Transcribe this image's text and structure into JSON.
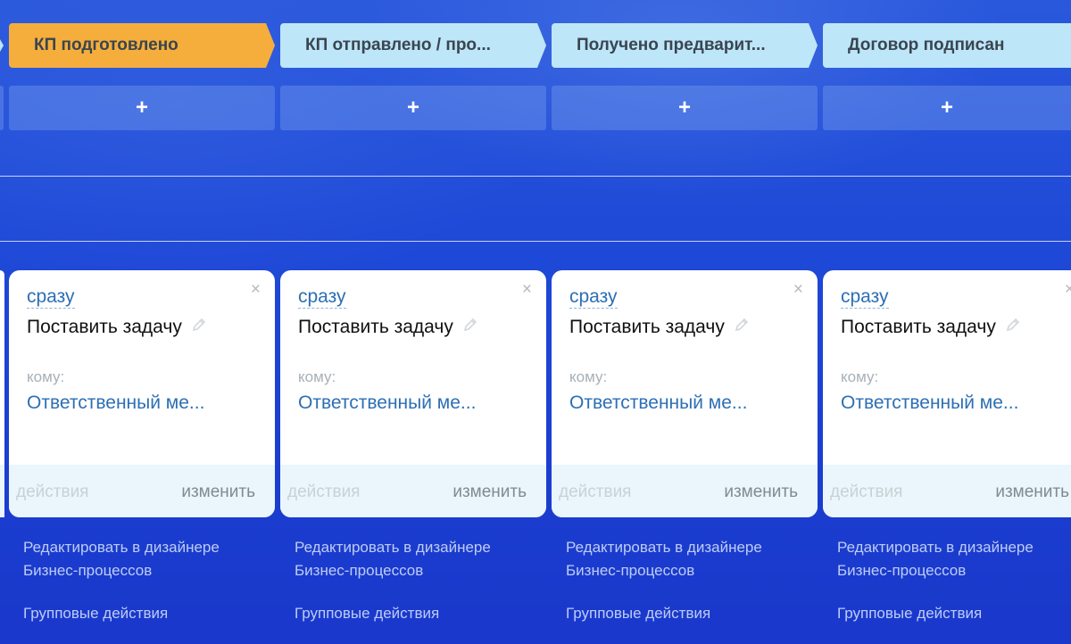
{
  "stages": [
    {
      "label": "КП подготовлено",
      "state": "active",
      "color": "#f5ae3c"
    },
    {
      "label": "КП отправлено / про...",
      "state": "normal",
      "color": "#bde6f8"
    },
    {
      "label": "Получено предварит...",
      "state": "normal",
      "color": "#bde6f8"
    },
    {
      "label": "Договор подписан",
      "state": "normal",
      "color": "#bde6f8"
    }
  ],
  "add_button": {
    "label": "+"
  },
  "cards": [
    {
      "when": "сразу",
      "close": "×",
      "task": "Поставить задачу",
      "whom_label": "кому:",
      "whom_value": "Ответственный ме...",
      "actions": "действия",
      "edit": "изменить"
    },
    {
      "when": "сразу",
      "close": "×",
      "task": "Поставить задачу",
      "whom_label": "кому:",
      "whom_value": "Ответственный ме...",
      "actions": "действия",
      "edit": "изменить"
    },
    {
      "when": "сразу",
      "close": "×",
      "task": "Поставить задачу",
      "whom_label": "кому:",
      "whom_value": "Ответственный ме...",
      "actions": "действия",
      "edit": "изменить"
    },
    {
      "when": "сразу",
      "close": "×",
      "task": "Поставить задачу",
      "whom_label": "кому:",
      "whom_value": "Ответственный ме...",
      "actions": "действия",
      "edit": "изменить"
    }
  ],
  "links": {
    "designer_line1": "Редактировать в дизайнере",
    "designer_line2": "Бизнес-процессов",
    "group_actions": "Групповые действия"
  },
  "icons": {
    "pencil": "pencil-icon",
    "close": "close-icon"
  },
  "colors": {
    "accent_link": "#2d6fb4",
    "active_stage": "#f5ae3c",
    "inactive_stage": "#bde6f8"
  }
}
